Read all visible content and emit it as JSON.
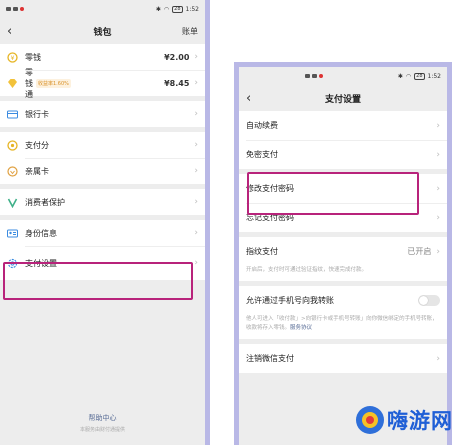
{
  "left": {
    "status": {
      "time": "1:52",
      "battery": "28"
    },
    "nav": {
      "title": "钱包",
      "right": "账单"
    },
    "rows": {
      "lingqian": {
        "label": "零钱",
        "value": "¥2.00"
      },
      "lingqiantong": {
        "label": "零钱通",
        "tag": "收益率1.60%",
        "value": "¥8.45"
      },
      "bank": {
        "label": "银行卡"
      },
      "zhifufen": {
        "label": "支付分"
      },
      "qinshuka": {
        "label": "亲属卡"
      },
      "protect": {
        "label": "消费者保护"
      },
      "identity": {
        "label": "身份信息"
      },
      "settings": {
        "label": "支付设置"
      }
    },
    "footer": {
      "help": "帮助中心",
      "sub": "本服务由财付通提供"
    }
  },
  "right": {
    "status": {
      "time": "1:52",
      "battery": "28"
    },
    "nav": {
      "title": "支付设置"
    },
    "rows": {
      "autorenew": {
        "label": "自动续费"
      },
      "nopwd": {
        "label": "免密支付"
      },
      "changepwd": {
        "label": "修改支付密码"
      },
      "forgetpwd": {
        "label": "忘记支付密码"
      },
      "fingerprint": {
        "label": "指纹支付",
        "value": "已开启"
      },
      "fingerprint_note": "开启后，支付时可通过验证指纹，快速完成付款。",
      "phone_transfer": {
        "label": "允许通过手机号向我转账"
      },
      "phone_note": "他人可进入「收付款」>向银行卡或手机号转账」向你微信绑定的手机号转账，收款将存入零钱。",
      "phone_note_link": "服务协议",
      "close": {
        "label": "注销微信支付"
      }
    }
  },
  "watermark": {
    "text": "嗨游网"
  },
  "colors": {
    "highlight": "#b8237b",
    "frame": "#b9b8e6",
    "link": "#576b95"
  }
}
